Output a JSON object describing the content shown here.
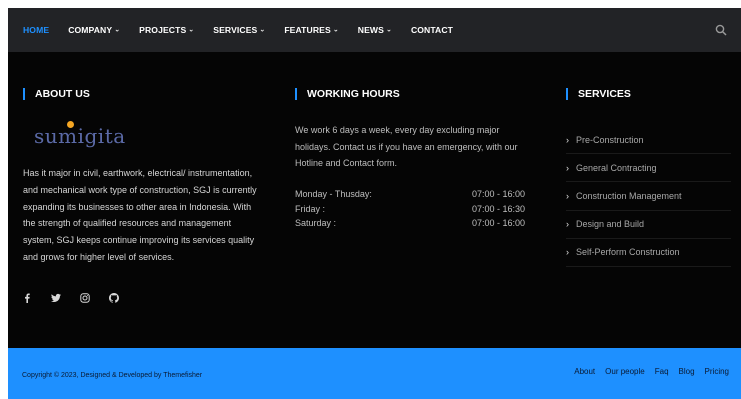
{
  "nav": {
    "items": [
      {
        "label": "HOME",
        "dropdown": false,
        "active": true
      },
      {
        "label": "COMPANY",
        "dropdown": true
      },
      {
        "label": "PROJECTS",
        "dropdown": true
      },
      {
        "label": "SERVICES",
        "dropdown": true
      },
      {
        "label": "FEATURES",
        "dropdown": true
      },
      {
        "label": "NEWS",
        "dropdown": true
      },
      {
        "label": "CONTACT",
        "dropdown": false
      }
    ],
    "search_icon": "search-icon"
  },
  "about": {
    "title": "ABOUT US",
    "logo_text": "sumigita",
    "description": "Has it major in civil, earthwork, electrical/ instrumentation, and mechanical work type of construction, SGJ is currently expanding its businesses to other area in Indonesia. With the strength of qualified resources and management system, SGJ keeps continue improving its services quality and grows for higher level of services.",
    "socials": [
      "facebook-icon",
      "twitter-icon",
      "instagram-icon",
      "github-icon"
    ]
  },
  "hours": {
    "title": "WORKING HOURS",
    "description": "We work 6 days a week, every day excluding major holidays. Contact us if you have an emergency, with our Hotline and Contact form.",
    "rows": [
      {
        "day": "Monday - Thusday:",
        "time": "07:00 - 16:00"
      },
      {
        "day": "Friday :",
        "time": "07:00 - 16:30"
      },
      {
        "day": "Saturday :",
        "time": "07:00 - 16:00"
      }
    ]
  },
  "services": {
    "title": "SERVICES",
    "items": [
      "Pre-Construction",
      "General Contracting",
      "Construction Management",
      "Design and Build",
      "Self-Perform Construction"
    ]
  },
  "footer": {
    "copyright": "Copyright © 2023, Designed & Developed by Themefisher",
    "links": [
      "About",
      "Our people",
      "Faq",
      "Blog",
      "Pricing"
    ]
  },
  "colors": {
    "accent": "#1e90ff",
    "nav_bg": "#222326",
    "body_bg": "#050505",
    "logo_dot": "#f5a623"
  }
}
